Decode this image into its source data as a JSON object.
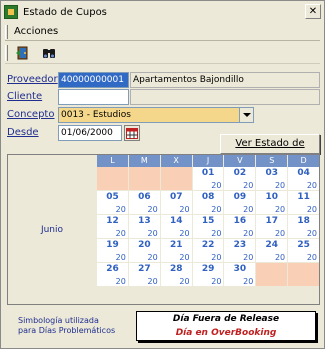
{
  "window": {
    "title": "Estado de Cupos"
  },
  "menu": {
    "acciones": "Acciones"
  },
  "toolbar": {
    "btn1_icon": "door-exit-icon",
    "btn2_icon": "binoculars-icon"
  },
  "form": {
    "proveedor_label": "Proveedor",
    "proveedor_code": "40000000001",
    "proveedor_name": "Apartamentos Bajondillo",
    "cliente_label": "Cliente",
    "cliente_code": "",
    "cliente_name": "",
    "concepto_label": "Concepto",
    "concepto_value": "0013 - Estudios",
    "desde_label": "Desde",
    "desde_value": "01/06/2000",
    "ver_button": "Ver Estado de Cupos"
  },
  "calendar": {
    "month": "Junio",
    "headers": [
      "L",
      "M",
      "X",
      "J",
      "V",
      "S",
      "D"
    ],
    "weeks": [
      [
        null,
        null,
        null,
        {
          "d": "01",
          "c": "20"
        },
        {
          "d": "02",
          "c": "20"
        },
        {
          "d": "03",
          "c": "20"
        },
        {
          "d": "04",
          "c": "20"
        }
      ],
      [
        {
          "d": "05",
          "c": "20"
        },
        {
          "d": "06",
          "c": "20"
        },
        {
          "d": "07",
          "c": "20"
        },
        {
          "d": "08",
          "c": "20"
        },
        {
          "d": "09",
          "c": "20"
        },
        {
          "d": "10",
          "c": "20"
        },
        {
          "d": "11",
          "c": "20"
        }
      ],
      [
        {
          "d": "12",
          "c": "20"
        },
        {
          "d": "13",
          "c": "20"
        },
        {
          "d": "14",
          "c": "20"
        },
        {
          "d": "15",
          "c": "20"
        },
        {
          "d": "16",
          "c": "20"
        },
        {
          "d": "17",
          "c": "20"
        },
        {
          "d": "18",
          "c": "20"
        }
      ],
      [
        {
          "d": "19",
          "c": "20"
        },
        {
          "d": "20",
          "c": "20"
        },
        {
          "d": "21",
          "c": "20"
        },
        {
          "d": "22",
          "c": "20"
        },
        {
          "d": "23",
          "c": "20"
        },
        {
          "d": "24",
          "c": "20"
        },
        {
          "d": "25",
          "c": "20"
        }
      ],
      [
        {
          "d": "26",
          "c": "20"
        },
        {
          "d": "27",
          "c": "20"
        },
        {
          "d": "28",
          "c": "20"
        },
        {
          "d": "29",
          "c": "20"
        },
        {
          "d": "30",
          "c": "20"
        },
        null,
        null
      ]
    ]
  },
  "legend": {
    "label_line1": "Simbología utilizada",
    "label_line2": "para Días Problemáticos",
    "fuera": "Día Fuera de Release",
    "overbooking": "Día en OverBooking"
  },
  "colors": {
    "header_blue": "#7392c7",
    "empty_cell": "#f9d0b5",
    "day_text": "#3060c0",
    "overbooking_text": "#c02020",
    "combo_bg": "#f4d78a"
  }
}
